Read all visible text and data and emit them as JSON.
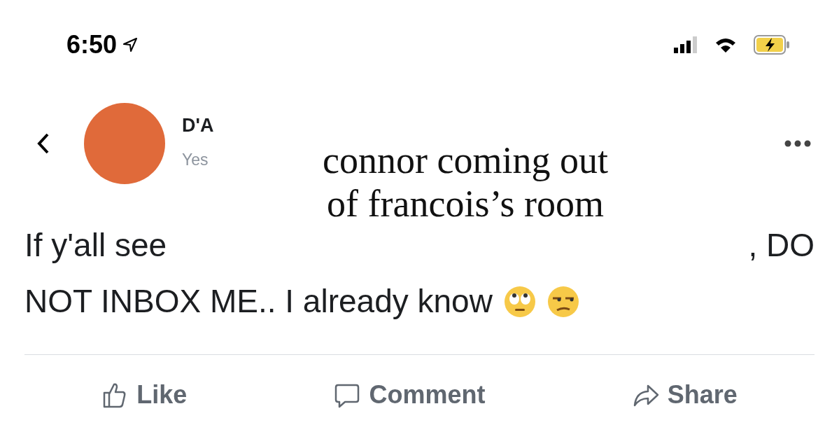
{
  "status_bar": {
    "time": "6:50"
  },
  "post": {
    "author": "D'A",
    "time": "Yes",
    "text_start": "If y'all see",
    "text_end": ", DO",
    "text_line2": "NOT INBOX ME.. I already know"
  },
  "caption": {
    "lines": [
      "connor coming out",
      "of francois’s room"
    ]
  },
  "actions": [
    {
      "kind": "like",
      "label": "Like"
    },
    {
      "kind": "comment",
      "label": "Comment"
    },
    {
      "kind": "share",
      "label": "Share"
    }
  ]
}
